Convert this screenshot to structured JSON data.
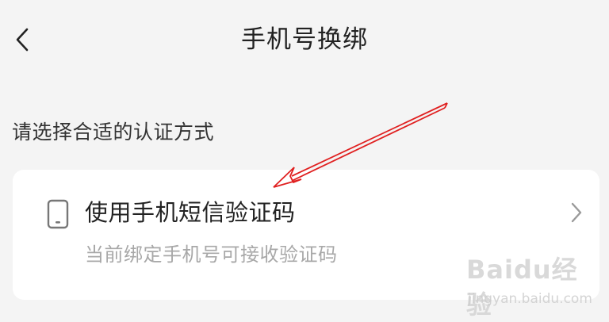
{
  "header": {
    "title": "手机号换绑",
    "back_icon": "chevron-left-icon"
  },
  "section": {
    "label": "请选择合适的认证方式"
  },
  "option": {
    "title": "使用手机短信验证码",
    "description": "当前绑定手机号可接收验证码",
    "icon": "phone-icon",
    "chevron_icon": "chevron-right-icon"
  },
  "annotation": {
    "color": "#e02020"
  },
  "watermark": {
    "logo": "Baidu经验",
    "url": "jingyan.baidu.com"
  }
}
